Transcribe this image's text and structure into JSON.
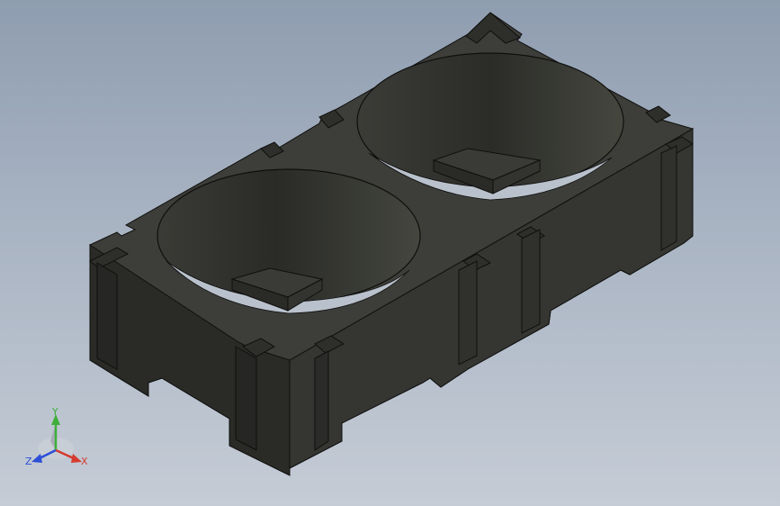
{
  "view": {
    "background_top": "#8f9db0",
    "background_bottom": "#c5ccd6",
    "model_colors": {
      "top_face": "#3c3d38",
      "left_face": "#2b2b28",
      "right_face": "#333431",
      "bore_wall": "#2d2e2a",
      "edge": "#0f0f0e"
    }
  },
  "model": {
    "description_icon": "battery-holder-2-cell",
    "cell_count": 2
  },
  "triad": {
    "x_label": "X",
    "y_label": "Y",
    "z_label": "Z",
    "x_color": "#d63a2f",
    "y_color": "#3fae3a",
    "z_color": "#2d4fd6"
  }
}
